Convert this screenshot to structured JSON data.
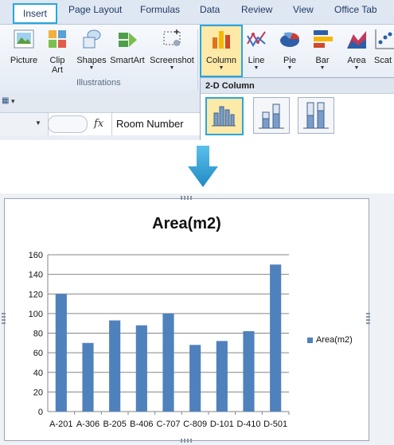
{
  "ribbon_tabs": [
    {
      "label": "Insert",
      "active": true
    },
    {
      "label": "Page Layout"
    },
    {
      "label": "Formulas"
    },
    {
      "label": "Data"
    },
    {
      "label": "Review"
    },
    {
      "label": "View"
    },
    {
      "label": "Office Tab"
    }
  ],
  "ribbon_buttons": {
    "picture": "Picture",
    "clip_art_line1": "Clip",
    "clip_art_line2": "Art",
    "shapes": "Shapes",
    "smartart": "SmartArt",
    "screenshot": "Screenshot",
    "column": "Column",
    "line": "Line",
    "pie": "Pie",
    "bar": "Bar",
    "area": "Area",
    "scatter": "Scat"
  },
  "group_label": "Illustrations",
  "dropdown": {
    "header": "2-D Column"
  },
  "formula_bar": {
    "fx": "fx",
    "value": "Room Number"
  },
  "colors": {
    "accent": "#27a7df",
    "bar": "#4f81bd",
    "arrow": "#2a9bd4"
  },
  "chart_data": {
    "type": "bar",
    "title": "Area(m2)",
    "categories": [
      "A-201",
      "A-306",
      "B-205",
      "B-406",
      "C-707",
      "C-809",
      "D-101",
      "D-410",
      "D-501"
    ],
    "series": [
      {
        "name": "Area(m2)",
        "values": [
          120,
          70,
          93,
          88,
          100,
          68,
          72,
          82,
          150
        ]
      }
    ],
    "ylim": [
      0,
      160
    ],
    "yticks": [
      0,
      20,
      40,
      60,
      80,
      100,
      120,
      140,
      160
    ],
    "grid": true,
    "legend": "right"
  }
}
